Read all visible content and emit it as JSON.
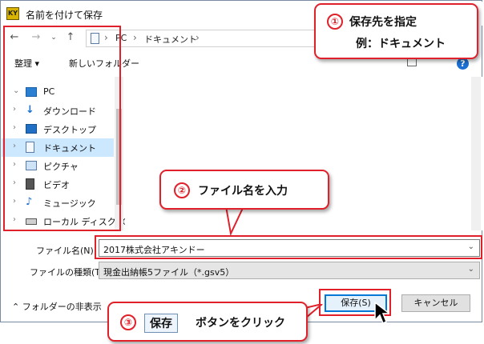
{
  "window": {
    "title": "名前を付けて保存",
    "app_icon_text": "KY"
  },
  "address": {
    "crumbs": [
      "PC",
      "ドキュメント"
    ],
    "separator": "›"
  },
  "toolbar": {
    "organize_label": "整理 ▾",
    "new_folder_label": "新しいフォルダー",
    "help_label": "?"
  },
  "nav": {
    "items": [
      {
        "label": "PC",
        "icon": "pc-icon"
      },
      {
        "label": "ダウンロード",
        "icon": "download-icon"
      },
      {
        "label": "デスクトップ",
        "icon": "desktop-icon"
      },
      {
        "label": "ドキュメント",
        "icon": "documents-icon",
        "selected": true
      },
      {
        "label": "ピクチャ",
        "icon": "pictures-icon"
      },
      {
        "label": "ビデオ",
        "icon": "video-icon"
      },
      {
        "label": "ミュージック",
        "icon": "music-icon"
      },
      {
        "label": "ローカル ディスク (C",
        "icon": "disk-icon"
      }
    ]
  },
  "fields": {
    "filename_label": "ファイル名(N):",
    "filename_value": "2017株式会社アキンドー",
    "filetype_label": "ファイルの種類(T):",
    "filetype_value": "現金出納帳5ファイル（*.gsv5）"
  },
  "footer": {
    "hide_folders_label": "フォルダーの非表示",
    "save_label": "保存(S)",
    "cancel_label": "キャンセル"
  },
  "callouts": {
    "c1": {
      "number": "①",
      "line1": "保存先を指定",
      "line2": "例：ドキュメント"
    },
    "c2": {
      "number": "②",
      "text": "ファイル名を入力"
    },
    "c3": {
      "number": "③",
      "keyword": "保存",
      "text": "ボタンをクリック"
    }
  },
  "colors": {
    "highlight": "#e0202a",
    "selection": "#cce8ff",
    "accent": "#0078d7"
  }
}
